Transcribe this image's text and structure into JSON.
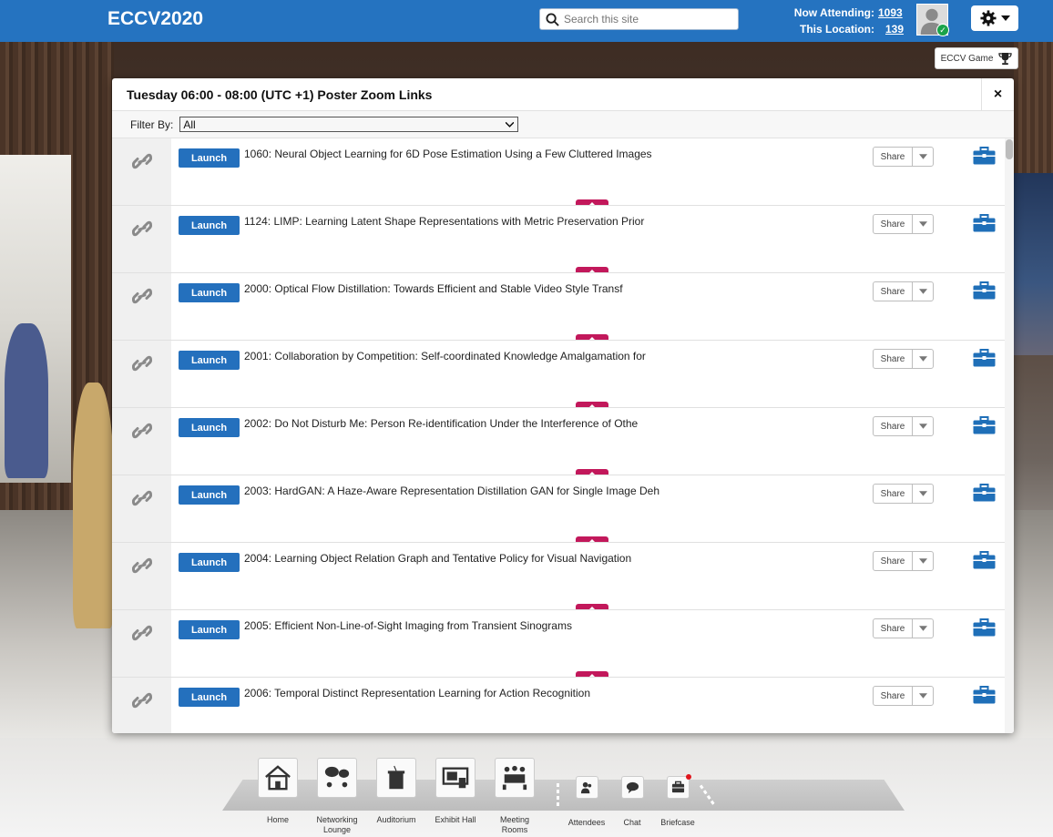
{
  "header": {
    "brand": "ECCV2020",
    "search_placeholder": "Search this site",
    "now_attending_label": "Now Attending:",
    "now_attending_value": "1093",
    "this_location_label": "This Location:",
    "this_location_value": "139",
    "game_button_label": "ECCV Game"
  },
  "modal": {
    "title": "Tuesday 06:00 - 08:00 (UTC +1) Poster Zoom Links",
    "close_label": "×",
    "filter_label": "Filter By:",
    "filter_value": "All",
    "launch_label": "Launch",
    "share_label": "Share",
    "rows": [
      {
        "title": "1060: Neural Object Learning for 6D Pose Estimation Using a Few Cluttered Images"
      },
      {
        "title": "1124: LIMP: Learning Latent Shape Representations with Metric Preservation Prior"
      },
      {
        "title": "2000: Optical Flow Distillation: Towards Efficient and Stable Video Style Transf"
      },
      {
        "title": "2001: Collaboration by Competition: Self-coordinated Knowledge Amalgamation for"
      },
      {
        "title": "2002: Do Not Disturb Me: Person Re-identification Under the Interference of Othe"
      },
      {
        "title": "2003: HardGAN: A Haze-Aware Representation Distillation GAN for Single Image Deh"
      },
      {
        "title": "2004: Learning Object Relation Graph and Tentative Policy for Visual Navigation"
      },
      {
        "title": "2005: Efficient Non-Line-of-Sight Imaging from Transient Sinograms"
      },
      {
        "title": "2006: Temporal Distinct Representation Learning for Action Recognition"
      }
    ]
  },
  "bottom_nav": {
    "home": "Home",
    "networking": "Networking Lounge",
    "auditorium": "Auditorium",
    "exhibit": "Exhibit Hall",
    "meeting": "Meeting Rooms",
    "attendees": "Attendees",
    "chat": "Chat",
    "briefcase": "Briefcase"
  },
  "colors": {
    "header_blue": "#2573c0",
    "launch_blue": "#2470bd",
    "tab_magenta": "#c2185b",
    "online_green": "#1aa34a",
    "notify_red": "#e0161d"
  }
}
